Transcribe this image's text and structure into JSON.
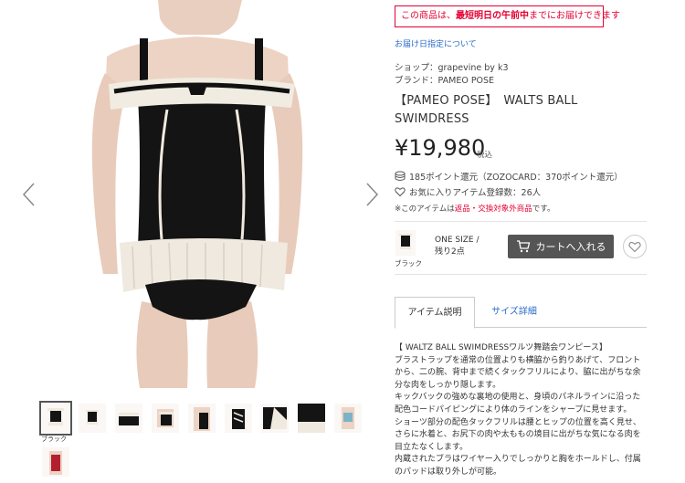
{
  "gallery": {
    "prev_label": "前へ",
    "next_label": "次へ",
    "active_caption": "ブラック"
  },
  "delivery": {
    "prefix": "この商品は、",
    "emphasis": "最短明日の午前中",
    "suffix": "までにお届けできます"
  },
  "delivery_date_link": "お届け日指定について",
  "shop_line": "ショップ：grapevine by k3",
  "brand_line": "ブランド：PAMEO POSE",
  "product_title": "【PAMEO POSE】　WALTS BALL SWIMDRESS",
  "price": "¥19,980",
  "tax_label": "税込",
  "points_text": "185ポイント還元（ZOZOCARD：370ポイント還元）",
  "favorites_text": "お気に入りアイテム登録数：26人",
  "notice": {
    "prefix": "※このアイテムは",
    "link": "返品・交換対象外商品",
    "suffix": "です。"
  },
  "sku": {
    "color": "ブラック",
    "size_line1": "ONE SIZE /",
    "size_line2": "残り2点",
    "cart_label": "カートへ入れる"
  },
  "tabs": [
    {
      "label": "アイテム説明"
    },
    {
      "label": "サイズ詳細"
    }
  ],
  "description": [
    "【 WALTZ BALL SWIMDRESSワルツ舞踏会ワンピース】",
    "ブラストラップを通常の位置よりも横脇から釣りあげて、フロント",
    "から、二の腕、背中まで続くタックフリルにより、脇に出がちな余",
    "分な肉をしっかり隠します。",
    "キックバックの強めな裏地の使用と、身頃のパネルラインに沿った",
    "配色コードパイピングにより体のラインをシャープに見せます。",
    "ショーツ部分の配色タックフリルは腰とヒップの位置を高く見せ、",
    "さらに水着と、お尻下の肉や太ももの境目に出がちな気になる肉を",
    "目立たなくします。",
    "内蔵されたブラはワイヤー入りでしっかりと胸をホールドし、付属",
    "のパッドは取り外しが可能。"
  ],
  "colors": {
    "accent_red": "#e60033",
    "link_blue": "#2a6cc9",
    "cart_button": "#555555"
  }
}
